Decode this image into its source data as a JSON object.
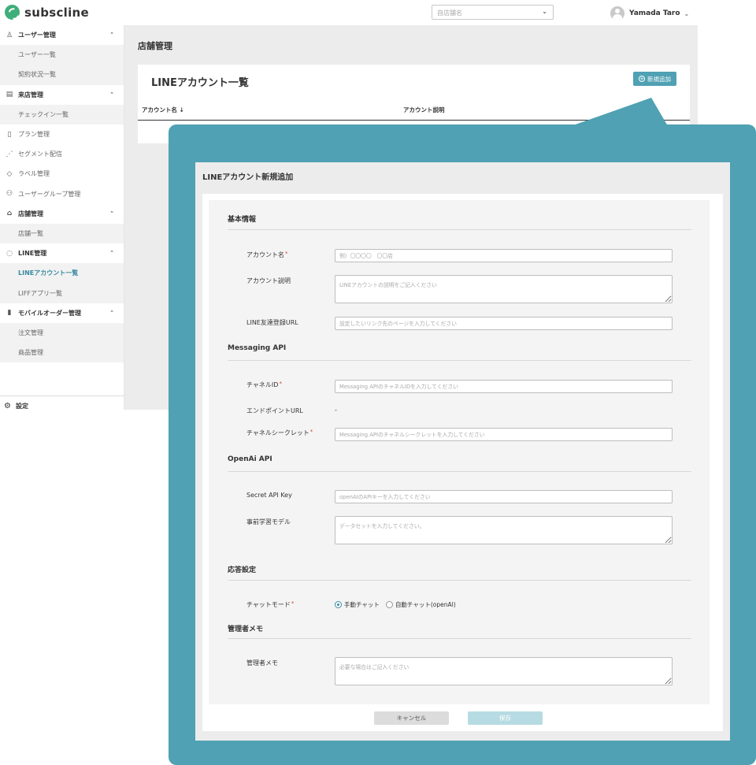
{
  "header": {
    "logo_text": "subscline",
    "store_select_placeholder": "自店舗名",
    "user_name": "Yamada Taro"
  },
  "sidebar": {
    "items": [
      {
        "label": "ユーザー管理",
        "type": "section",
        "icon": "user-icon",
        "caret": "up"
      },
      {
        "label": "ユーザー一覧",
        "type": "sub"
      },
      {
        "label": "契約状況一覧",
        "type": "sub"
      },
      {
        "label": "来店管理",
        "type": "section",
        "icon": "visit-icon",
        "caret": "up"
      },
      {
        "label": "チェックイン一覧",
        "type": "sub"
      },
      {
        "label": "プラン管理",
        "type": "plain",
        "icon": "document-icon"
      },
      {
        "label": "セグメント配信",
        "type": "plain",
        "icon": "rss-icon"
      },
      {
        "label": "ラベル管理",
        "type": "plain",
        "icon": "tag-icon"
      },
      {
        "label": "ユーザーグループ管理",
        "type": "plain",
        "icon": "group-icon"
      },
      {
        "label": "店舗管理",
        "type": "section",
        "icon": "store-icon",
        "caret": "up"
      },
      {
        "label": "店舗一覧",
        "type": "sub"
      },
      {
        "label": "LINE管理",
        "type": "section",
        "icon": "chat-icon",
        "caret": "up"
      },
      {
        "label": "LINEアカウント一覧",
        "type": "sub",
        "active": true
      },
      {
        "label": "LIFFアプリ一覧",
        "type": "sub"
      },
      {
        "label": "モバイルオーダー管理",
        "type": "section",
        "icon": "mobile-icon",
        "caret": "up"
      },
      {
        "label": "注文管理",
        "type": "sub"
      },
      {
        "label": "商品管理",
        "type": "sub"
      }
    ],
    "settings_label": "設定"
  },
  "main": {
    "page_title": "店舗管理",
    "card_title": "LINEアカウント一覧",
    "add_button": "新規追加",
    "table_headers": [
      "アカウント名",
      "アカウント説明"
    ],
    "sort_indicator": "↓"
  },
  "modal": {
    "title": "LINEアカウント新規追加",
    "sections": {
      "basic": "基本情報",
      "messaging": "Messaging API",
      "openai": "OpenAi API",
      "response": "応答設定",
      "memo": "管理者メモ"
    },
    "fields": {
      "account_name": {
        "label": "アカウント名",
        "required": "*",
        "placeholder": "例）〇〇〇〇　〇〇店"
      },
      "account_desc": {
        "label": "アカウント説明",
        "placeholder": "LINEアカウントの説明をご記入ください"
      },
      "friend_url": {
        "label": "LINE友達登録URL",
        "placeholder": "設定したいリンク先のページを入力してください"
      },
      "channel_id": {
        "label": "チャネルID",
        "required": "*",
        "placeholder": "Messaging APIのチャネルIDを入力してください"
      },
      "endpoint_url": {
        "label": "エンドポイントURL",
        "value": "-"
      },
      "channel_secret": {
        "label": "チャネルシークレット",
        "required": "*",
        "placeholder": "Messaging APIのチャネルシークレットを入力してください"
      },
      "secret_api_key": {
        "label": "Secret API Key",
        "placeholder": "openAIのAPIキーを入力してください"
      },
      "pretrained_model": {
        "label": "事前学習モデル",
        "placeholder": "データセットを入力してください。"
      },
      "chat_mode": {
        "label": "チャットモード",
        "required": "*",
        "options": [
          "手動チャット",
          "自動チャット(openAI)"
        ],
        "selected": "手動チャット"
      },
      "admin_memo": {
        "label": "管理者メモ",
        "placeholder": "必要な場合はご記入ください"
      }
    },
    "cancel_button": "キャンセル",
    "save_button": "保存"
  }
}
